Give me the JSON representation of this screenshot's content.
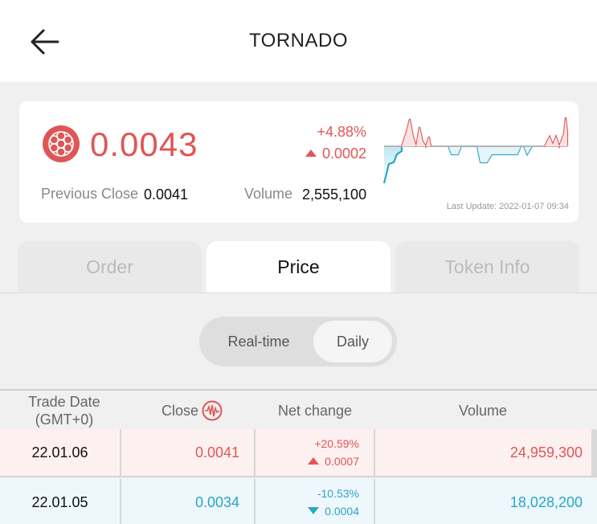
{
  "header": {
    "title": "TORNADO"
  },
  "summary": {
    "price": "0.0043",
    "change_percent": "+4.88%",
    "change_value": "0.0002",
    "previous_close_label": "Previous Close",
    "previous_close": "0.0041",
    "volume_label": "Volume",
    "volume": "2,555,100",
    "last_update": "Last Update: 2022-01-07 09:34"
  },
  "tabs": [
    {
      "label": "Order",
      "active": false
    },
    {
      "label": "Price",
      "active": true
    },
    {
      "label": "Token Info",
      "active": false
    }
  ],
  "period_toggle": {
    "options": [
      "Real-time",
      "Daily"
    ],
    "selected": "Daily"
  },
  "table": {
    "columns": [
      "Trade Date\n(GMT+0)",
      "Close",
      "Net change",
      "Volume"
    ],
    "rows": [
      {
        "date": "22.01.06",
        "close": "0.0041",
        "pct": "+20.59%",
        "net": "0.0007",
        "volume": "24,959,300",
        "direction": "up"
      },
      {
        "date": "22.01.05",
        "close": "0.0034",
        "pct": "-10.53%",
        "net": "0.0004",
        "volume": "18,028,200",
        "direction": "down"
      }
    ]
  },
  "colors": {
    "up": "#e05656",
    "down": "#2aa6c9"
  }
}
